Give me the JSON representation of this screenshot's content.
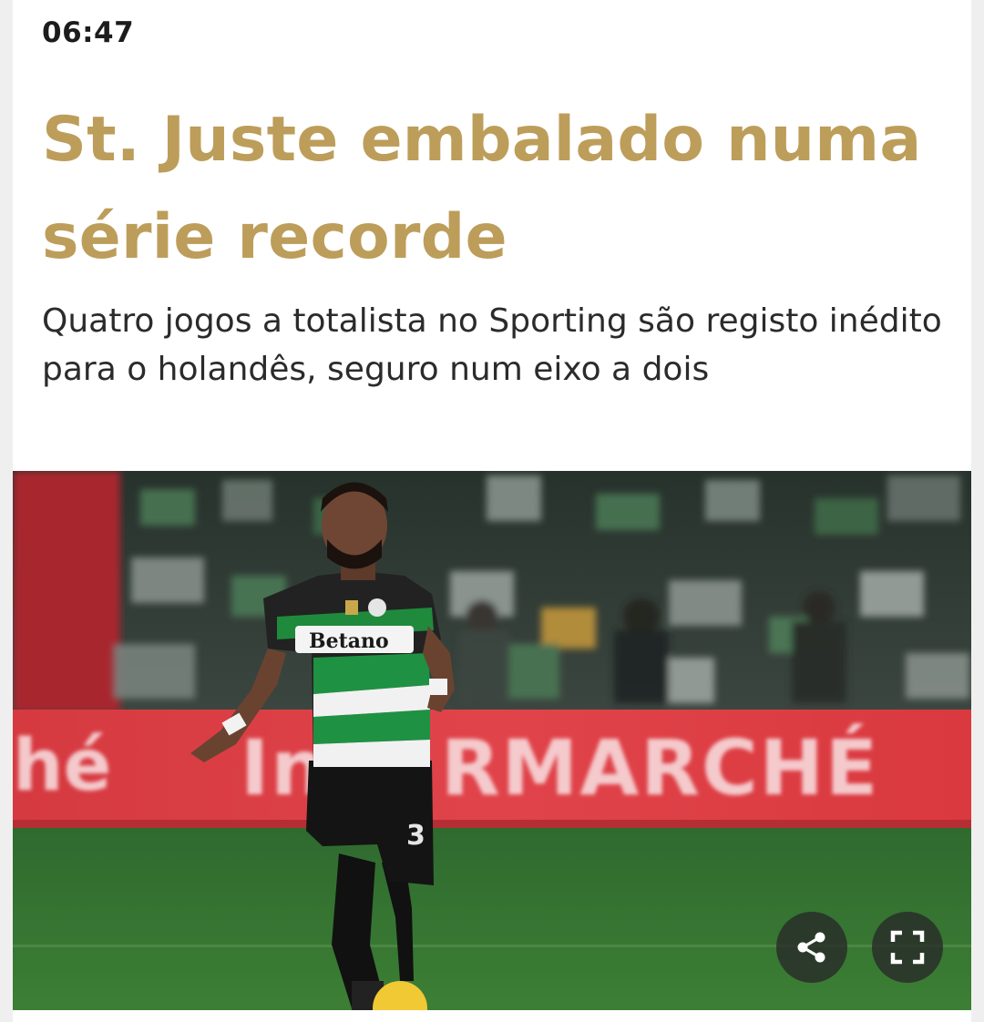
{
  "article": {
    "time": "06:47",
    "headline": "St. Juste embalado numa série recorde",
    "subtitle": "Quatro jogos a totalista no Sporting são registo inédito para o holandês, seguro num eixo a dois"
  },
  "photo": {
    "banner_text": "Intermarché",
    "shirt_sponsor": "Betano",
    "shirt_number": "3",
    "buttons": {
      "share_icon": "share-icon",
      "fullscreen_icon": "fullscreen-icon"
    }
  },
  "colors": {
    "headline": "#bd9d5a",
    "subtitle": "#2b2b2b",
    "time": "#1c1c1c",
    "overlay_button": "#282828"
  }
}
